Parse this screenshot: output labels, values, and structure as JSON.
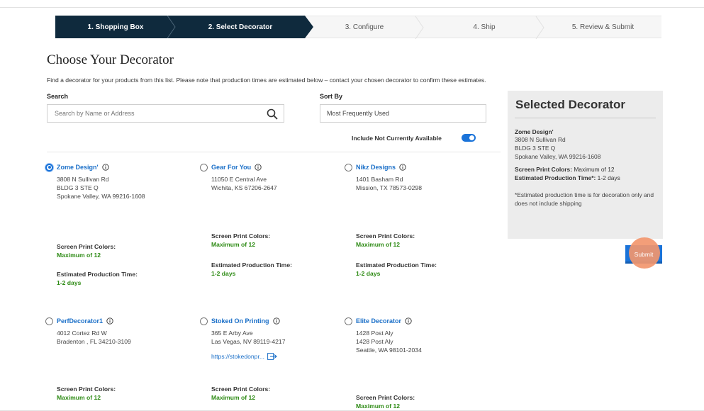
{
  "stepper": {
    "steps": [
      {
        "label": "1. Shopping Box",
        "state": "done"
      },
      {
        "label": "2. Select Decorator",
        "state": "active"
      },
      {
        "label": "3. Configure",
        "state": "todo"
      },
      {
        "label": "4. Ship",
        "state": "todo"
      },
      {
        "label": "5. Review & Submit",
        "state": "todo"
      }
    ]
  },
  "page": {
    "title": "Choose Your Decorator",
    "intro": "Find a decorator for your products from this list. Please note that production times are estimated below – contact your chosen decorator to confirm these estimates."
  },
  "search": {
    "label": "Search",
    "placeholder": "Search by Name or Address",
    "icon": "search-icon"
  },
  "sort": {
    "label": "Sort By",
    "selected": "Most Frequently Used"
  },
  "toggle": {
    "label": "Include Not Currently Available",
    "on": true,
    "color": "#1a73d9"
  },
  "attr_labels": {
    "colors": "Screen Print Colors:",
    "time": "Estimated Production Time:"
  },
  "decorators": [
    {
      "name": "Zome Design'",
      "selected": true,
      "address": [
        "3808 N Sullivan Rd",
        "BLDG 3 STE Q",
        "Spokane Valley, WA 99216-1608"
      ],
      "colors": "Maximum of 12",
      "time": "1-2 days"
    },
    {
      "name": "Gear For You",
      "selected": false,
      "address": [
        "11050 E Central Ave",
        "Wichita, KS 67206-2647"
      ],
      "colors": "Maximum of 12",
      "time": "1-2 days"
    },
    {
      "name": "Nikz Designs",
      "selected": false,
      "address": [
        "1401 Basham Rd",
        "Mission, TX 78573-0298"
      ],
      "colors": "Maximum of 12",
      "time": "1-2 days"
    },
    {
      "name": "PerfDecorator1",
      "selected": false,
      "address": [
        "4012 Cortez Rd W",
        "Bradenton , FL 34210-3109"
      ],
      "colors": "Maximum of 12"
    },
    {
      "name": "Stoked On Printing",
      "selected": false,
      "address": [
        "365 E Arby Ave",
        "Las Vegas, NV 89119-4217"
      ],
      "link": "https://stokedonpr...",
      "colors": "Maximum of 12"
    },
    {
      "name": "Elite Decorator",
      "selected": false,
      "address": [
        "1428 Post Aly",
        "1428 Post Aly",
        "Seattle, WA 98101-2034"
      ],
      "colors": "Maximum of 12"
    }
  ],
  "panel": {
    "title": "Selected Decorator",
    "name": "Zome Design'",
    "address": [
      "3808 N Sullivan Rd",
      "BLDG 3 STE Q",
      "Spokane Valley, WA 99216-1608"
    ],
    "colors_label": "Screen Print Colors:",
    "colors_value": "Maximum of 12",
    "time_label": "Estimated Production Time*:",
    "time_value": "1-2 days",
    "note": "*Estimated production time is for decoration only and does not include shipping"
  },
  "submit": {
    "label": "Submit",
    "color": "#1a73d9"
  },
  "colors": {
    "nav": "#0f2a3d",
    "link": "#1a6fc8",
    "value_green": "#2e8b15"
  }
}
